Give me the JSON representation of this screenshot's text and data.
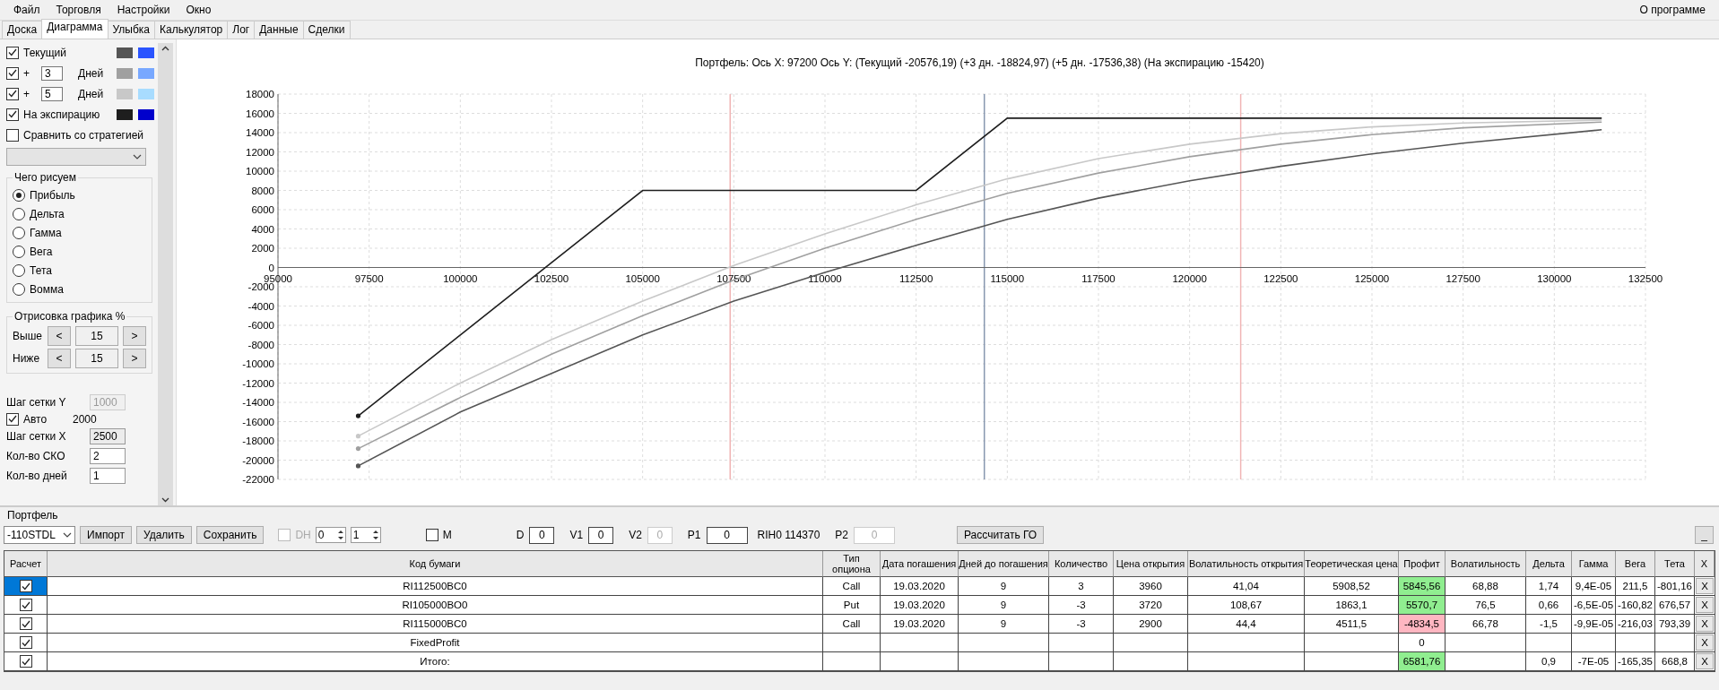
{
  "menu": [
    {
      "label": "Файл"
    },
    {
      "label": "Торговля"
    },
    {
      "label": "Настройки"
    },
    {
      "label": "Окно"
    }
  ],
  "about": "О программе",
  "tabs": [
    {
      "label": "Доска",
      "selected": false
    },
    {
      "label": "Диаграмма",
      "selected": true
    },
    {
      "label": "Улыбка",
      "selected": false
    },
    {
      "label": "Калькулятор",
      "selected": false
    },
    {
      "label": "Лог",
      "selected": false
    },
    {
      "label": "Данные",
      "selected": false
    },
    {
      "label": "Сделки",
      "selected": false
    }
  ],
  "legend": [
    {
      "kind": "check",
      "label": "Текущий",
      "checked": true,
      "swatches": [
        {
          "color": "#555555"
        },
        {
          "color": "#2a54ff"
        }
      ]
    },
    {
      "kind": "days",
      "prefix": "+",
      "value": "3",
      "unit": "Дней",
      "checked": true,
      "swatches": [
        {
          "color": "#a0a0a0"
        },
        {
          "color": "#78a8ff"
        }
      ]
    },
    {
      "kind": "days",
      "prefix": "+",
      "value": "5",
      "unit": "Дней",
      "checked": true,
      "swatches": [
        {
          "color": "#c8c8c8"
        },
        {
          "color": "#a8dcff"
        }
      ]
    },
    {
      "kind": "check",
      "label": "На экспирацию",
      "checked": true,
      "swatches": [
        {
          "color": "#1e1e1e"
        },
        {
          "color": "#0000cc"
        }
      ]
    },
    {
      "kind": "check",
      "label": "Сравнить со стратегией",
      "checked": false
    }
  ],
  "draw_what": {
    "title": "Чего рисуем",
    "options": [
      {
        "label": "Прибыль",
        "selected": true
      },
      {
        "label": "Дельта",
        "selected": false
      },
      {
        "label": "Гамма",
        "selected": false
      },
      {
        "label": "Вега",
        "selected": false
      },
      {
        "label": "Тета",
        "selected": false
      },
      {
        "label": "Вомма",
        "selected": false
      }
    ]
  },
  "range": {
    "title": "Отрисовка графика %",
    "rows": [
      {
        "label": "Выше",
        "dec": "<",
        "value": "15",
        "inc": ">"
      },
      {
        "label": "Ниже",
        "dec": "<",
        "value": "15",
        "inc": ">"
      }
    ]
  },
  "grid_y": {
    "label": "Шаг сетки Y",
    "value": "1000",
    "disabled": true
  },
  "auto": {
    "label": "Авто",
    "checked": true,
    "value": "2000"
  },
  "grid_x": {
    "label": "Шаг сетки X",
    "value": "2500"
  },
  "sko": {
    "label": "Кол-во СКО",
    "value": "2"
  },
  "days_count": {
    "label": "Кол-во дней",
    "value": "1"
  },
  "chart": {
    "chart_data": {
      "type": "line",
      "title": "Портфель: Ось X: 97200 Ось Y:  (Текущий -20576,19)  (+3 дн. -18824,97)  (+5 дн. -17536,38)  (На экспирацию -15420)",
      "x": [
        97200,
        100000,
        102500,
        105000,
        107500,
        110000,
        112500,
        115000,
        117500,
        120000,
        122500,
        125000,
        127500,
        131300
      ],
      "series": [
        {
          "color": "#555555",
          "values": [
            -20600,
            -15000,
            -11000,
            -7000,
            -3500,
            -500,
            2300,
            5000,
            7200,
            9000,
            10500,
            11800,
            12900,
            14300
          ]
        },
        {
          "color": "#a0a0a0",
          "values": [
            -18800,
            -13500,
            -9000,
            -5000,
            -1300,
            2000,
            5000,
            7700,
            9800,
            11500,
            12800,
            13800,
            14500,
            15100
          ]
        },
        {
          "color": "#c8c8c8",
          "values": [
            -17500,
            -12000,
            -7500,
            -3500,
            200,
            3500,
            6500,
            9200,
            11300,
            12800,
            13900,
            14600,
            15000,
            15300
          ]
        },
        {
          "color": "#1e1e1e",
          "values": [
            -15400,
            -7000,
            500,
            8000,
            8000,
            8000,
            8000,
            15500,
            15500,
            15500,
            15500,
            15500,
            15500,
            15500
          ]
        }
      ],
      "grid": true,
      "xlim": [
        95000,
        132500
      ],
      "ylim": [
        -22000,
        18000
      ],
      "xticks": [
        95000,
        97500,
        100000,
        102500,
        105000,
        107500,
        110000,
        112500,
        115000,
        117500,
        120000,
        122500,
        125000,
        127500,
        130000,
        132500
      ],
      "yticks": [
        -22000,
        -20000,
        -18000,
        -16000,
        -14000,
        -12000,
        -10000,
        -8000,
        -6000,
        -4000,
        -2000,
        0,
        2000,
        4000,
        6000,
        8000,
        10000,
        12000,
        14000,
        16000,
        18000
      ],
      "ref_lines": [
        {
          "axis": "x",
          "value": 107400,
          "color": "#f0b4b4"
        },
        {
          "axis": "x",
          "value": 114370,
          "color": "#8898b0"
        },
        {
          "axis": "x",
          "value": 121400,
          "color": "#f0b4b4"
        }
      ]
    }
  },
  "portfolio": {
    "title": "Портфель",
    "strategy": "-110STDL",
    "buttons": [
      "Импорт",
      "Удалить",
      "Сохранить"
    ],
    "dh": {
      "label": "DH",
      "checked": false,
      "disabled": true
    },
    "spinners": [
      "0",
      "1"
    ],
    "m": {
      "label": "M",
      "checked": false
    },
    "fields": [
      {
        "kind": "field",
        "label": "D",
        "value": "0",
        "disabled": false
      },
      {
        "kind": "field",
        "label": "V1",
        "value": "0",
        "disabled": false
      },
      {
        "kind": "field",
        "label": "V2",
        "value": "0",
        "disabled": true
      },
      {
        "kind": "field",
        "label": "P1",
        "value": "0",
        "disabled": false
      },
      {
        "kind": "text",
        "text": "RIH0 114370"
      },
      {
        "kind": "field",
        "label": "P2",
        "value": "0",
        "disabled": true
      }
    ],
    "calc_button": "Рассчитать ГО",
    "minimize": "_"
  },
  "table": {
    "columns": [
      "Расчет",
      "Код бумаги",
      "Тип опциона",
      "Дата погашения",
      "Дней до погашения",
      "Количество",
      "Цена открытия",
      "Волатильность открытия",
      "Теоретическая цена",
      "Профит",
      "Волатильность",
      "Дельта",
      "Гамма",
      "Вега",
      "Тета",
      "X"
    ],
    "rows": [
      {
        "checked": true,
        "selected": true,
        "cells": [
          "",
          "RI112500BC0",
          "Call",
          "19.03.2020",
          "9",
          "3",
          "3960",
          "41,04",
          "5908,52",
          "5845,56",
          "68,88",
          "1,74",
          "9,4E-05",
          "211,5",
          "-801,16",
          "X"
        ],
        "color": "#90ee90"
      },
      {
        "checked": true,
        "selected": false,
        "cells": [
          "",
          "RI105000BO0",
          "Put",
          "19.03.2020",
          "9",
          "-3",
          "3720",
          "108,67",
          "1863,1",
          "5570,7",
          "76,5",
          "0,66",
          "-6,5E-05",
          "-160,82",
          "676,57",
          "X"
        ],
        "color": "#90ee90"
      },
      {
        "checked": true,
        "selected": false,
        "cells": [
          "",
          "RI115000BC0",
          "Call",
          "19.03.2020",
          "9",
          "-3",
          "2900",
          "44,4",
          "4511,5",
          "-4834,5",
          "66,78",
          "-1,5",
          "-9,9E-05",
          "-216,03",
          "793,39",
          "X"
        ],
        "color": "#ffb6c1"
      },
      {
        "checked": true,
        "selected": false,
        "cells": [
          "",
          "FixedProfit",
          "",
          "",
          "",
          "",
          "",
          "",
          "",
          "0",
          "",
          "",
          "",
          "",
          "",
          "X"
        ]
      },
      {
        "checked": true,
        "selected": false,
        "cells": [
          "",
          "Итого:",
          "",
          "",
          "",
          "",
          "",
          "",
          "",
          "6581,76",
          "",
          "0,9",
          "-7E-05",
          "-165,35",
          "668,8",
          "X"
        ],
        "color": "#90ee90"
      }
    ]
  }
}
